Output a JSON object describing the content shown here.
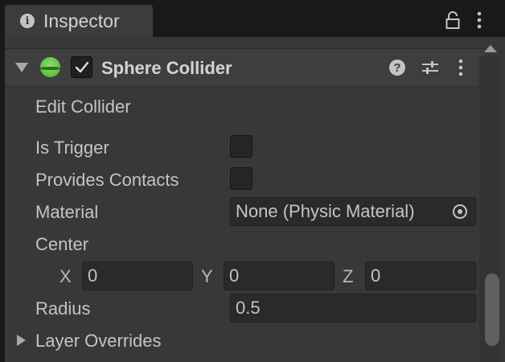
{
  "tab": {
    "title": "Inspector",
    "icons": [
      "info-icon",
      "lock-icon",
      "kebab-menu-icon"
    ]
  },
  "component": {
    "title": "Sphere Collider",
    "enabled": true,
    "icons": [
      "foldout-arrow-icon",
      "sphere-collider-icon",
      "help-icon",
      "presets-icon",
      "kebab-menu-icon"
    ]
  },
  "properties": {
    "edit_collider_label": "Edit Collider",
    "is_trigger": {
      "label": "Is Trigger",
      "checked": false
    },
    "provides_contacts": {
      "label": "Provides Contacts",
      "checked": false
    },
    "material": {
      "label": "Material",
      "value": "None (Physic Material)"
    },
    "center": {
      "label": "Center",
      "x_label": "X",
      "x": "0",
      "y_label": "Y",
      "y": "0",
      "z_label": "Z",
      "z": "0"
    },
    "radius": {
      "label": "Radius",
      "value": "0.5"
    },
    "layer_overrides": {
      "label": "Layer Overrides"
    }
  },
  "colors": {
    "background": "#191919",
    "panel": "#383838",
    "header": "#3e3e3e",
    "field": "#2a2a2a",
    "text": "#c4c4c4",
    "sphere_green": "#5fbf3d"
  }
}
